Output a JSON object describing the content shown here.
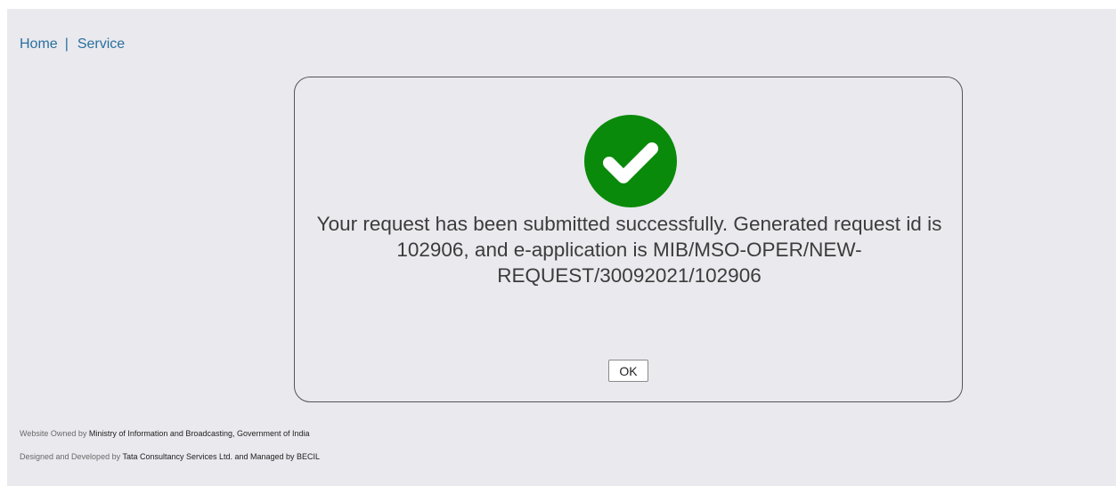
{
  "breadcrumb": {
    "home": "Home",
    "separator": "|",
    "service": "Service"
  },
  "dialog": {
    "icon": "check-circle-icon",
    "message": "Your request has been submitted successfully. Generated request id is 102906, and e-application is MIB/MSO-OPER/NEW-REQUEST/30092021/102906",
    "ok_label": "OK",
    "success_color": "#0a8a0a"
  },
  "footer": {
    "owned_label": "Website Owned by",
    "owned_value": "Ministry of Information and Broadcasting, Government of India",
    "designed_label": "Designed and Developed by",
    "designed_value": "Tata Consultancy Services Ltd. and Managed by BECIL"
  }
}
